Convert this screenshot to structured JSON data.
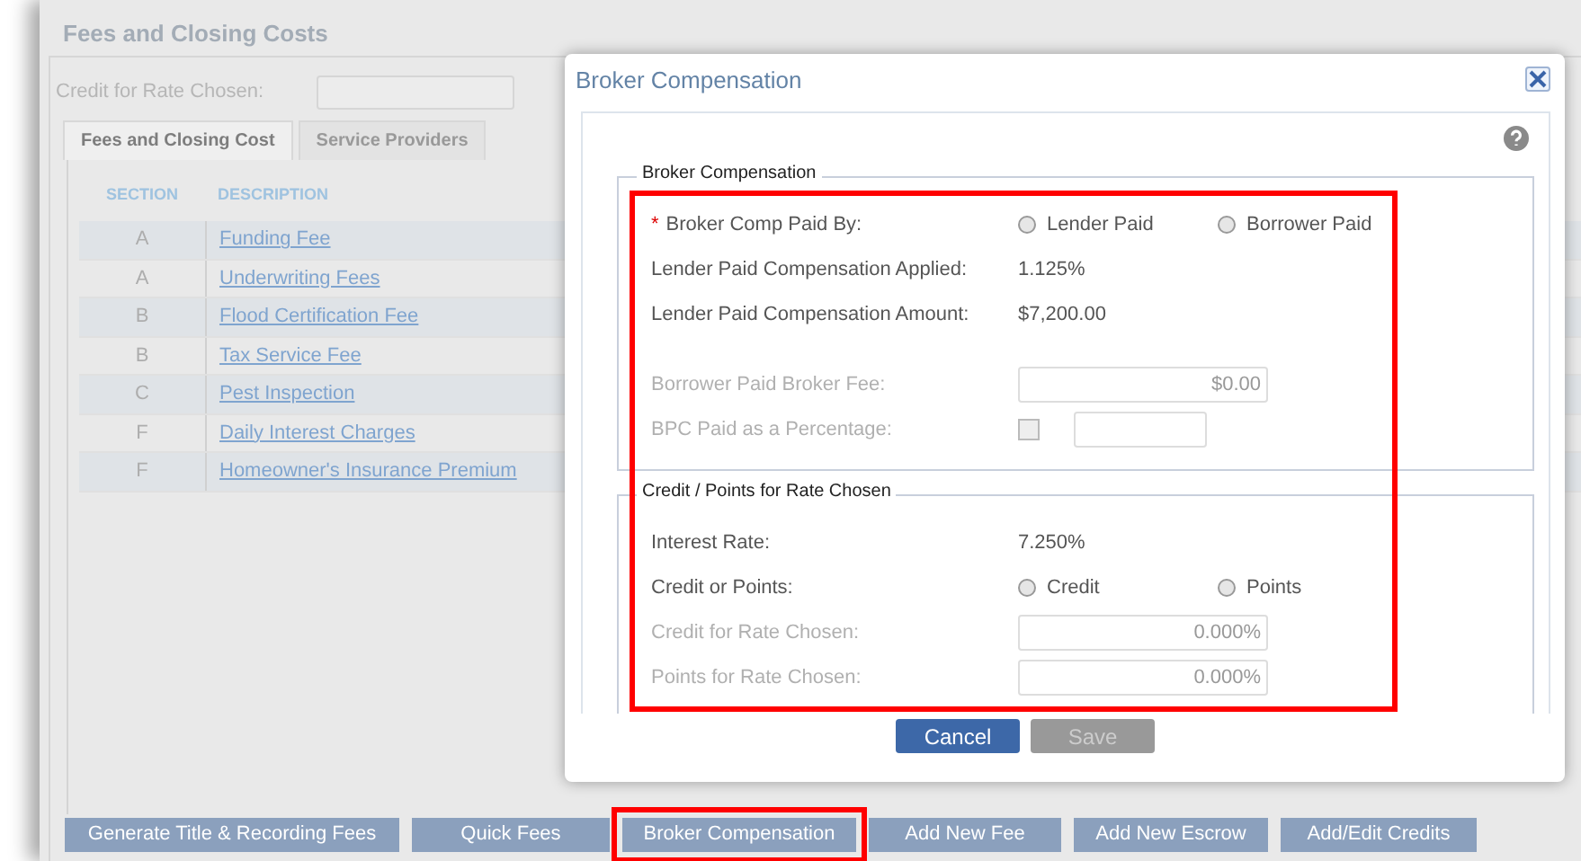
{
  "page": {
    "title": "Fees and Closing Costs",
    "credit_label": "Credit for Rate Chosen:",
    "tabs": [
      {
        "label": "Fees and Closing Cost",
        "selected": true
      },
      {
        "label": "Service Providers",
        "selected": false
      }
    ],
    "table": {
      "columns": [
        "SECTION",
        "DESCRIPTION"
      ],
      "rows": [
        {
          "section": "A",
          "description": "Funding Fee"
        },
        {
          "section": "A",
          "description": "Underwriting Fees"
        },
        {
          "section": "B",
          "description": "Flood Certification Fee"
        },
        {
          "section": "B",
          "description": "Tax Service Fee"
        },
        {
          "section": "C",
          "description": "Pest Inspection"
        },
        {
          "section": "F",
          "description": "Daily Interest Charges"
        },
        {
          "section": "F",
          "description": "Homeowner's Insurance Premium"
        }
      ]
    },
    "buttons": [
      {
        "label": "Generate Title & Recording Fees",
        "highlighted": false
      },
      {
        "label": "Quick Fees",
        "highlighted": false
      },
      {
        "label": "Broker Compensation",
        "highlighted": true
      },
      {
        "label": "Add New Fee",
        "highlighted": false
      },
      {
        "label": "Add New Escrow",
        "highlighted": false
      },
      {
        "label": "Add/Edit Credits",
        "highlighted": false
      }
    ]
  },
  "dialog": {
    "title": "Broker Compensation",
    "highlighted": true,
    "sections": [
      {
        "legend": "Broker Compensation",
        "rows": [
          {
            "kind": "radio",
            "label": "Broker Comp Paid By:",
            "required_mark": "*",
            "options": [
              {
                "label": "Lender Paid",
                "selected": false
              },
              {
                "label": "Borrower Paid",
                "selected": false
              }
            ]
          },
          {
            "kind": "text",
            "label": "Lender Paid Compensation Applied:",
            "value": "1.125%"
          },
          {
            "kind": "text",
            "label": "Lender Paid Compensation Amount:",
            "value": "$7,200.00"
          },
          {
            "kind": "spacer"
          },
          {
            "kind": "input",
            "label": "Borrower Paid Broker Fee:",
            "disabled": true,
            "value": "$0.00"
          },
          {
            "kind": "checkinput",
            "label": "BPC Paid as a Percentage:",
            "disabled": true,
            "checked": false
          }
        ]
      },
      {
        "legend": "Credit / Points for Rate Chosen",
        "rows": [
          {
            "kind": "text",
            "label": "Interest Rate:",
            "value": "7.250%"
          },
          {
            "kind": "radio",
            "label": "Credit or Points:",
            "options": [
              {
                "label": "Credit",
                "selected": false
              },
              {
                "label": "Points",
                "selected": false
              }
            ]
          },
          {
            "kind": "input",
            "label": "Credit for Rate Chosen:",
            "disabled": true,
            "value": "0.000%"
          },
          {
            "kind": "input",
            "label": "Points for Rate Chosen:",
            "disabled": true,
            "value": "0.000%"
          }
        ]
      }
    ],
    "buttons": [
      {
        "label": "Cancel",
        "disabled": false
      },
      {
        "label": "Save",
        "disabled": true
      }
    ]
  }
}
